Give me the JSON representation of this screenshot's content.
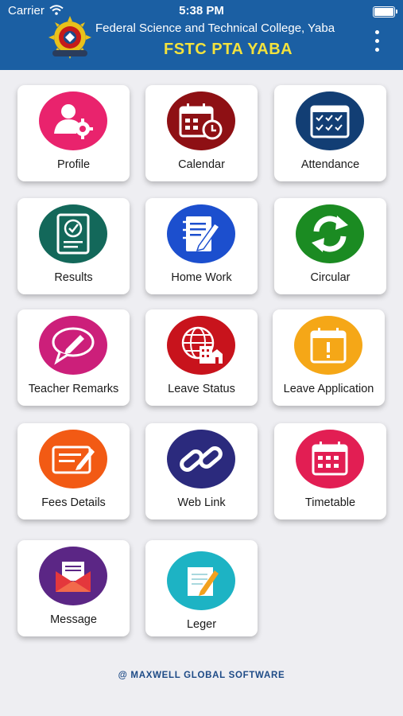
{
  "status": {
    "carrier": "Carrier",
    "time": "5:38 PM"
  },
  "header": {
    "school": "Federal Science and Technical College, Yaba",
    "pta": "FSTC PTA YABA"
  },
  "tiles": [
    {
      "label": "Profile",
      "color": "#e9236d"
    },
    {
      "label": "Calendar",
      "color": "#8e1014"
    },
    {
      "label": "Attendance",
      "color": "#123e74"
    },
    {
      "label": "Results",
      "color": "#13685a"
    },
    {
      "label": "Home Work",
      "color": "#1c4fce"
    },
    {
      "label": "Circular",
      "color": "#1b8b22"
    },
    {
      "label": "Teacher Remarks",
      "color": "#cc1f7a"
    },
    {
      "label": "Leave Status",
      "color": "#c8131c"
    },
    {
      "label": "Leave Application",
      "color": "#f5a717"
    },
    {
      "label": "Fees Details",
      "color": "#f25a14"
    },
    {
      "label": "Web Link",
      "color": "#2b2a7d"
    },
    {
      "label": "Timetable",
      "color": "#e21e53"
    },
    {
      "label": "Message",
      "color": "#5b2685"
    },
    {
      "label": "Leger",
      "color": "#1db3c4"
    }
  ],
  "footer": "@ MAXWELL GLOBAL SOFTWARE"
}
